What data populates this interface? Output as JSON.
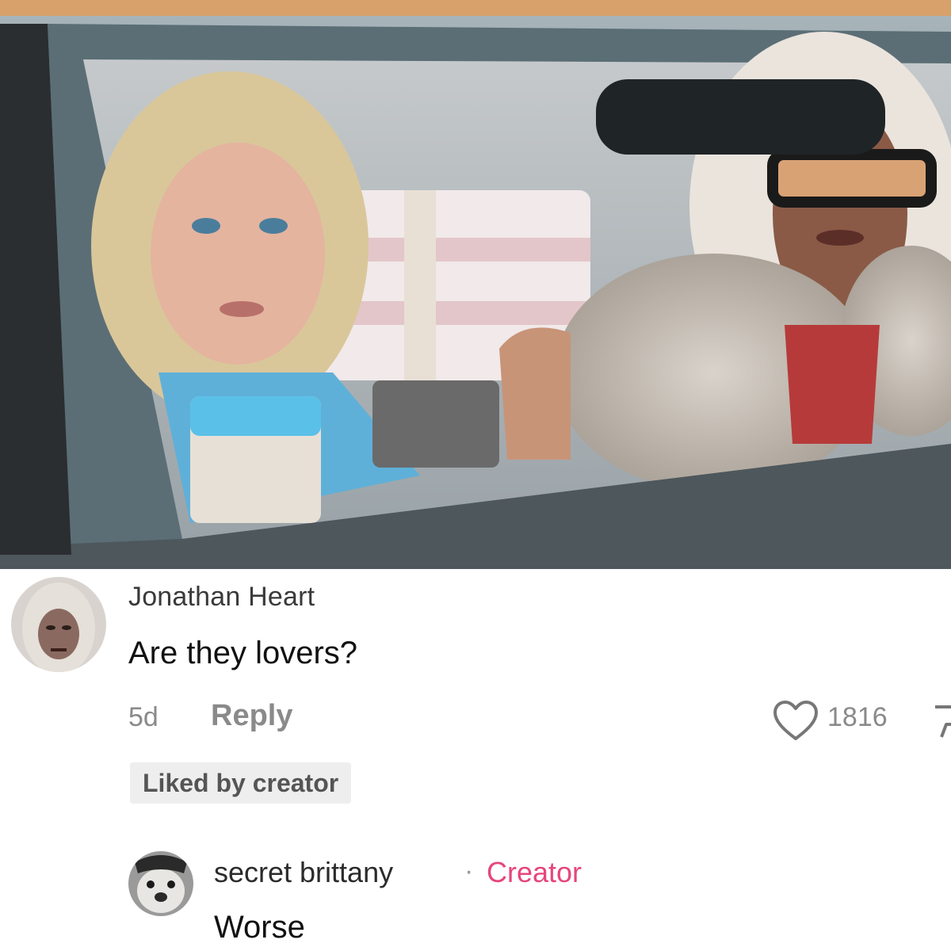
{
  "post": {
    "image": {
      "description_icon": "photo-image"
    }
  },
  "comments": [
    {
      "author": "Jonathan Heart",
      "text": "Are they lovers?",
      "time": "5d",
      "reply_label": "Reply",
      "likes": "1816",
      "liked_by_creator_label": "Liked by creator",
      "like_icon": "heart-icon",
      "dislike_icon": "dislike-icon"
    }
  ],
  "replies": [
    {
      "author": "secret brittany",
      "separator": "·",
      "badge": "Creator",
      "text": "Worse"
    }
  ],
  "colors": {
    "creator_badge": "#e6467a",
    "muted_text": "#8a8a8a",
    "primary_text": "#111111"
  }
}
